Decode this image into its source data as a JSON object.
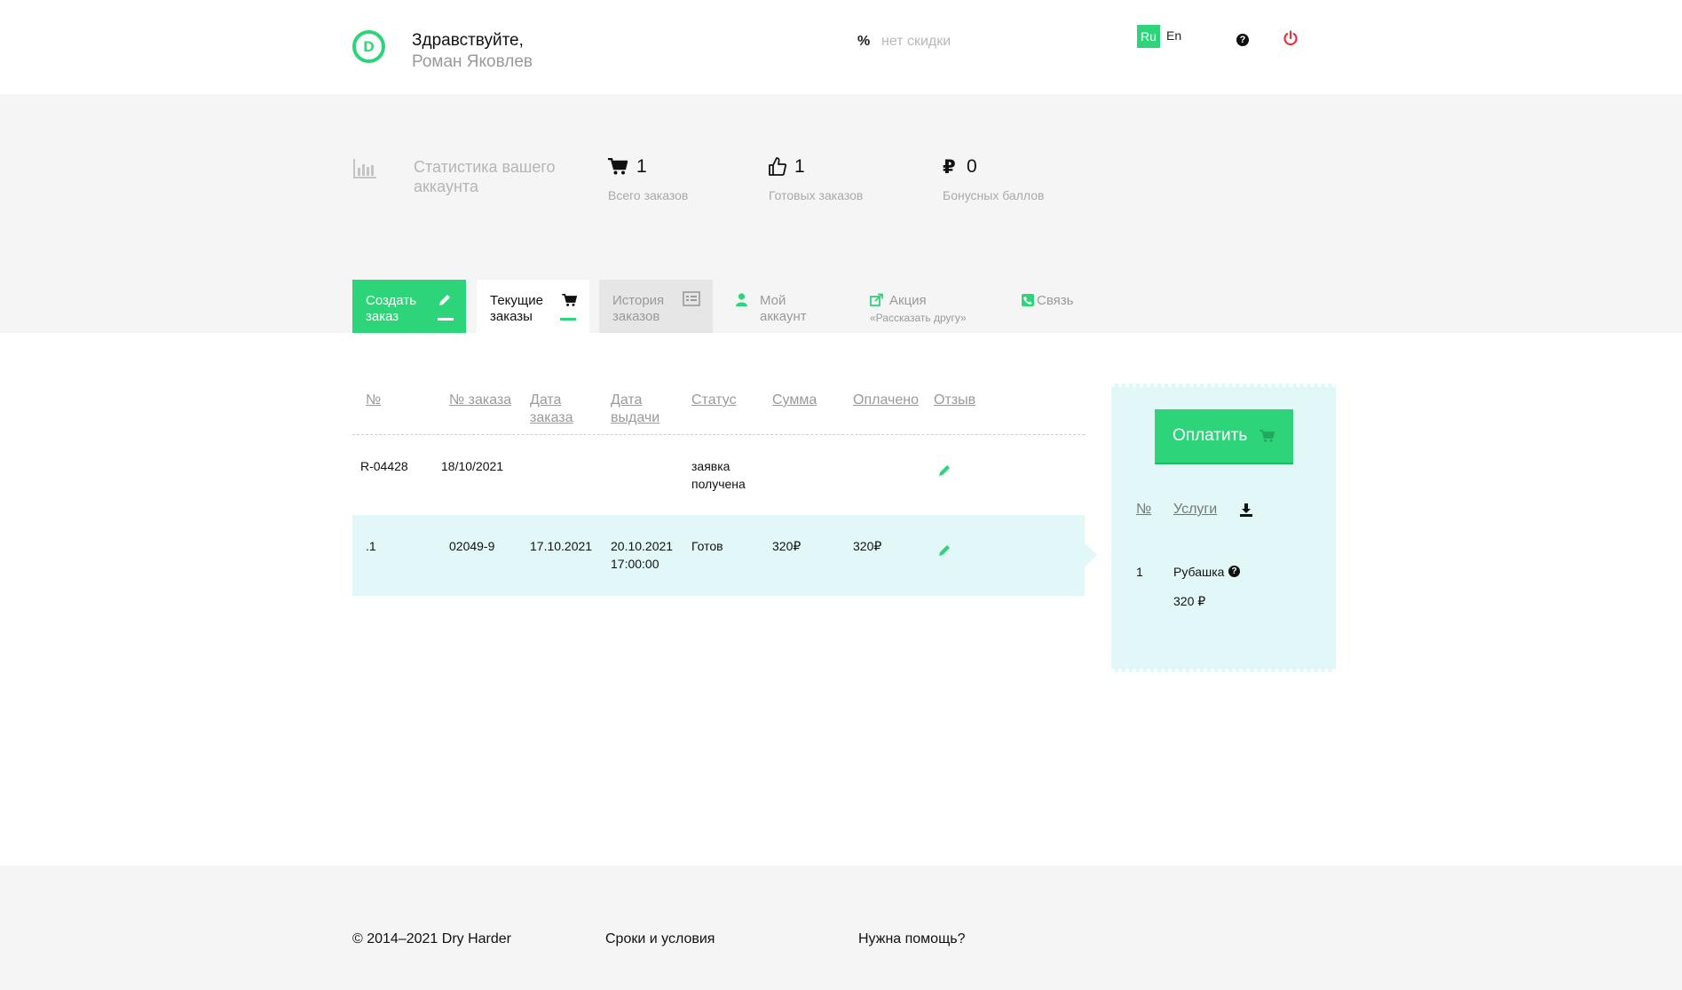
{
  "header": {
    "greeting": "Здравствуйте,",
    "user_name": "Роман Яковлев",
    "discount_symbol": "%",
    "discount_text": "нет скидки",
    "lang_ru": "Ru",
    "lang_en": "En",
    "help_symbol": "?"
  },
  "stats": {
    "title": "Статистика вашего аккаунта",
    "total_orders": {
      "value": "1",
      "label": "Всего заказов"
    },
    "ready_orders": {
      "value": "1",
      "label": "Готовых заказов"
    },
    "bonus_points": {
      "value": "0",
      "label": "Бонусных баллов"
    }
  },
  "tabs": {
    "create": "Создать заказ",
    "current": "Текущие заказы",
    "history": "История заказов",
    "account": "Мой аккаунт",
    "promo": "Акция",
    "promo_sub": "«Рассказать другу»",
    "contact": "Связь"
  },
  "table": {
    "headers": [
      "№",
      "№ заказа",
      "Дата заказа",
      "Дата выдачи",
      "Статус",
      "Сумма",
      "Оплачено",
      "Отзыв"
    ],
    "rows": [
      {
        "num": "",
        "order": "R-04428",
        "order_date": "18/10/2021",
        "issue_date": "",
        "status": "заявка получена",
        "sum": "",
        "paid": ""
      },
      {
        "num": ".1",
        "order": "02049-9",
        "order_date": "17.10.2021",
        "issue_date": "20.10.2021 17:00:00",
        "status": "Готов",
        "sum": "320₽",
        "paid": "320₽"
      }
    ]
  },
  "side": {
    "pay_button": "Оплатить",
    "col_num": "№",
    "col_services": "Услуги",
    "item_num": "1",
    "item_name": "Рубашка",
    "item_price": "320 ₽"
  },
  "footer": {
    "copyright": "© 2014–2021 Dry Harder",
    "terms": "Сроки и условия",
    "help": "Нужна помощь?"
  },
  "colors": {
    "accent": "#2ed47a",
    "highlight": "#e2f8f8",
    "band": "#f5f5f5",
    "power": "#e8323c"
  }
}
